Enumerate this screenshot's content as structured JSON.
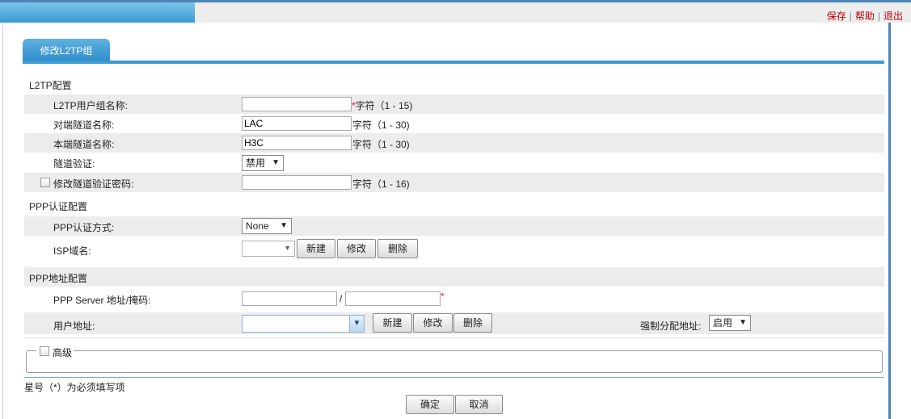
{
  "top_links": {
    "save": "保存",
    "help": "帮助",
    "logout": "退出",
    "sep": "|"
  },
  "tab": {
    "label": "修改L2TP组"
  },
  "l2tp": {
    "section_title": "L2TP配置",
    "group_name": {
      "label": "L2TP用户组名称:",
      "value": "",
      "required": "*",
      "hint": "字符（1 - 15)"
    },
    "peer_tunnel": {
      "label": "对端隧道名称:",
      "value": "LAC",
      "hint": "字符（1 - 30)"
    },
    "local_tunnel": {
      "label": "本端隧道名称:",
      "value": "H3C",
      "hint": "字符（1 - 30)"
    },
    "tunnel_auth": {
      "label": "隧道验证:",
      "value": "禁用"
    },
    "tunnel_pwd": {
      "label": "修改隧道验证密码:",
      "value": "",
      "hint": "字符（1 - 16)"
    }
  },
  "ppp_auth": {
    "section_title": "PPP认证配置",
    "auth_mode": {
      "label": "PPP认证方式:",
      "value": "None"
    },
    "isp_domain": {
      "label": "ISP域名:",
      "value": ""
    }
  },
  "ppp_addr": {
    "section_title": "PPP地址配置",
    "server": {
      "label": "PPP Server 地址/掩码:",
      "address": "",
      "mask": "",
      "slash": "/",
      "required": "*"
    },
    "user_addr": {
      "label": "用户地址:",
      "value": ""
    },
    "force_assign": {
      "label": "强制分配地址:",
      "value": "启用"
    }
  },
  "buttons": {
    "new": "新建",
    "modify": "修改",
    "delete": "删除",
    "ok": "确定",
    "cancel": "取消"
  },
  "advanced": {
    "label": "高级"
  },
  "footnote": "星号（*）为必须填写项",
  "colors": {
    "accent": "#3b9ad2",
    "required": "#e02020",
    "link": "#c00000"
  }
}
